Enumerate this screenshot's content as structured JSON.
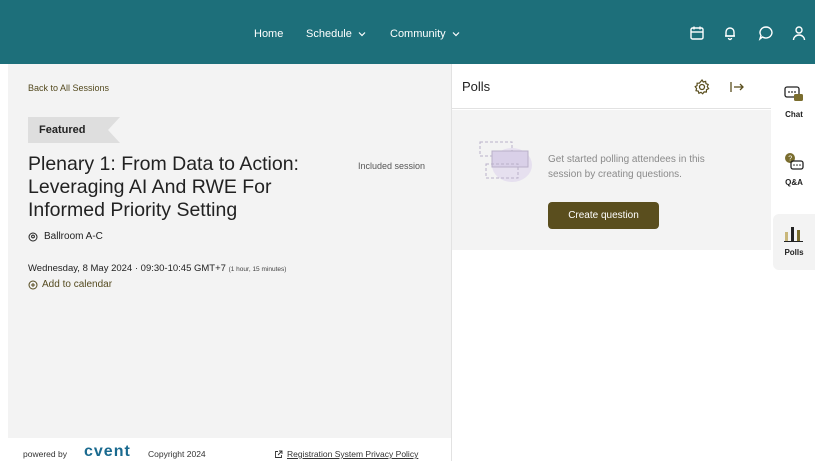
{
  "nav": {
    "home": "Home",
    "schedule": "Schedule",
    "community": "Community"
  },
  "session": {
    "back_link": "Back to All Sessions",
    "badge": "Featured",
    "title": "Plenary 1: From Data to Action: Leveraging AI And RWE For Informed Priority Setting",
    "included": "Included session",
    "location": "Ballroom A-C",
    "datetime": "Wednesday, 8 May 2024 · 09:30-10:45 GMT+7",
    "duration": "(1 hour, 15 minutes)",
    "add_calendar": "Add to calendar"
  },
  "footer": {
    "powered_by": "powered by",
    "brand": "cvent",
    "copyright": "Copyright 2024",
    "privacy": "Registration System Privacy Policy"
  },
  "polls": {
    "title": "Polls",
    "empty_text": "Get started polling attendees in this session by creating questions.",
    "create_button": "Create question"
  },
  "rail": {
    "chat": "Chat",
    "qa": "Q&A",
    "polls": "Polls"
  },
  "colors": {
    "nav_bg": "#1d6f7a",
    "accent": "#5a4e1e",
    "panel_bg": "#f3f3f3",
    "brand": "#1a6a8f"
  }
}
